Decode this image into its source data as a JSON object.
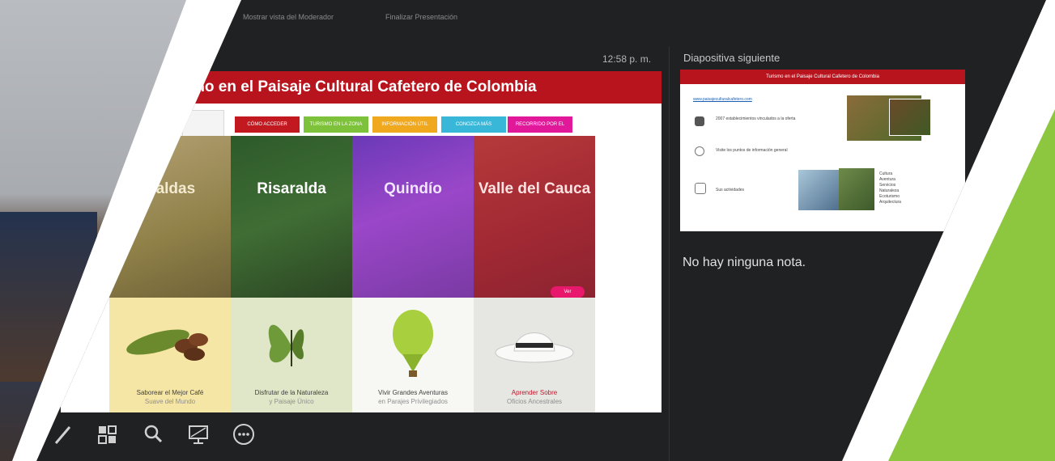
{
  "presenter": {
    "clock": "12:58 p. m.",
    "next_slide_label": "Diapositiva siguiente",
    "notes_text": "No hay ninguna nota."
  },
  "topbar": {
    "item1": "Mostrar vista del Moderador",
    "item2": "Finalizar Presentación"
  },
  "slide": {
    "title": "mo en el Paisaje Cultural Cafetero de Colombia",
    "tabs": [
      {
        "label": "CÓMO ACCEDER",
        "color": "#c2181f"
      },
      {
        "label": "TURISMO EN LA ZONA",
        "color": "#7ec13a"
      },
      {
        "label": "INFORMACIÓN ÚTIL",
        "color": "#f0a81f"
      },
      {
        "label": "CONOZCA MÁS",
        "color": "#38b7d8"
      },
      {
        "label": "RECORRIDO POR EL PAISAJE",
        "color": "#e2189a"
      }
    ],
    "regions": [
      {
        "name": "Caldas",
        "text_color": "#f3ead0"
      },
      {
        "name": "Risaralda",
        "text_color": "#ffffff"
      },
      {
        "name": "Quindío",
        "text_color": "#f2e5ff"
      },
      {
        "name": "Valle del Cauca",
        "text_color": "#ffe3e3"
      }
    ],
    "cards": [
      {
        "main": "Saborear el Mejor Café",
        "sub": "Suave del Mundo"
      },
      {
        "main": "Disfrutar de la Naturaleza",
        "sub": "y Paisaje Único"
      },
      {
        "main": "Vivir Grandes Aventuras",
        "sub": "en Parajes Privilegiados"
      },
      {
        "main": "Aprender Sobre",
        "sub": "Oficios Ancestrales"
      }
    ],
    "badge": "Ver"
  },
  "next_slide": {
    "title": "Turismo en el Paisaje Cultural Cafetero de Colombia",
    "link": "www.paisajeculturalcafetero.com",
    "row1": "2007 establecimientos vinculados a la oferta",
    "row2": "Visite los puntos de información general",
    "row3": "Sus actividades",
    "list": [
      "Cultura",
      "Aventura",
      "Servicios",
      "Naturaleza",
      "Ecoturismo",
      "Arquitectura"
    ]
  },
  "toolbar": {
    "tools": [
      "pen-icon",
      "slides-grid-icon",
      "zoom-icon",
      "screen-icon",
      "more-icon"
    ]
  },
  "colors": {
    "panel": "#202122",
    "accent_red": "#b8141e",
    "accent_green": "#8dc63f"
  }
}
